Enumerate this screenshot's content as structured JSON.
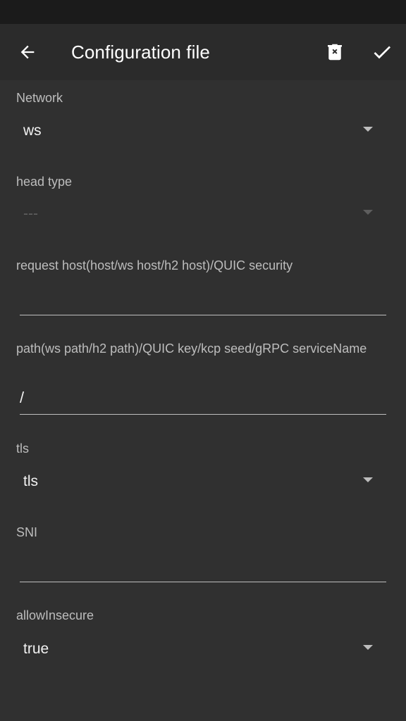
{
  "app_bar": {
    "title": "Configuration file",
    "back_icon": "arrow-left-icon",
    "delete_icon": "delete-icon",
    "save_icon": "check-icon"
  },
  "form": {
    "network": {
      "label": "Network",
      "value": "ws"
    },
    "head_type": {
      "label": "head type",
      "value": "---"
    },
    "request_host": {
      "label": "request host(host/ws host/h2 host)/QUIC security",
      "value": ""
    },
    "path": {
      "label": "path(ws path/h2 path)/QUIC key/kcp seed/gRPC serviceName",
      "value": "/"
    },
    "tls": {
      "label": "tls",
      "value": "tls"
    },
    "sni": {
      "label": "SNI",
      "value": ""
    },
    "allow_insecure": {
      "label": "allowInsecure",
      "value": "true"
    }
  },
  "colors": {
    "background": "#303030",
    "app_bar": "#2b2b2b",
    "status_bar": "#1b1b1b"
  }
}
